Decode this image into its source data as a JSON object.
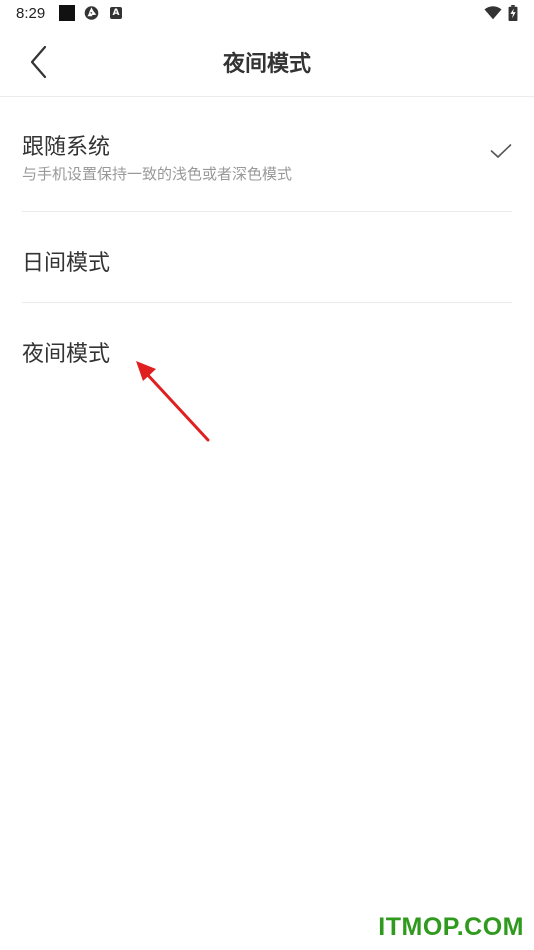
{
  "status_bar": {
    "time": "8:29",
    "icons": [
      "square-notification-icon",
      "aperture-icon",
      "a-notification-icon",
      "wifi-icon",
      "battery-charging-icon"
    ]
  },
  "app_bar": {
    "title": "夜间模式",
    "back_icon": "back-chevron-icon"
  },
  "options": [
    {
      "title": "跟随系统",
      "subtitle": "与手机设置保持一致的浅色或者深色模式",
      "selected": true
    },
    {
      "title": "日间模式",
      "selected": false
    },
    {
      "title": "夜间模式",
      "selected": false
    }
  ],
  "annotation": {
    "type": "red-arrow",
    "color": "#e02020",
    "target": "夜间模式"
  },
  "watermark": {
    "text": "ITMOP.COM",
    "color": "#2f9a1e"
  },
  "colors": {
    "background": "#ffffff",
    "title_text": "#333333",
    "subtitle_text": "#999999",
    "divider": "#ebebeb"
  }
}
